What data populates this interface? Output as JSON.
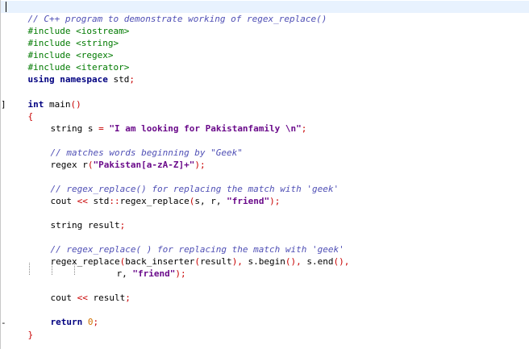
{
  "code": {
    "line1_comment": "// C++ program to demonstrate working of regex_replace()",
    "inc_iostream": "#include <iostream>",
    "inc_string": "#include <string>",
    "inc_regex": "#include <regex>",
    "inc_iterator": "#include <iterator>",
    "using_kw": "using namespace",
    "using_std": " std",
    "semicolon": ";",
    "int_kw": "int",
    "main_name": " main",
    "parens": "()",
    "open_brace": "{",
    "close_brace": "}",
    "string_kw": "string",
    "var_s": " s ",
    "assign": "=",
    "str_value": " \"I am looking for Pakistanfamily \\n\"",
    "comment_geek1": "// matches words beginning by \"Geek\"",
    "regex_decl": "regex r",
    "paren_open": "(",
    "regex_pattern": "\"Pakistan[a-zA-Z]+\"",
    "paren_close_semi": ");",
    "comment_replace1": "// regex_replace() for replacing the match with 'geek'",
    "cout": "cout ",
    "shift_op": "<<",
    "std_call": " std",
    "scope_op": "::",
    "regex_replace_fn": "regex_replace",
    "args_s_r": "s, r, ",
    "friend_str": "\"friend\"",
    "string_result": "string result",
    "comment_replace2": "// regex_replace( ) for replacing the match with 'geek'",
    "regex_replace_call": "regex_replace",
    "back_inserter": "back_inserter",
    "result_arg": "result",
    "s_begin": " s.begin",
    "s_end": " s.end",
    "r_arg": "r, ",
    "cout_result": " result",
    "return_kw": "return",
    "zero": " 0"
  }
}
